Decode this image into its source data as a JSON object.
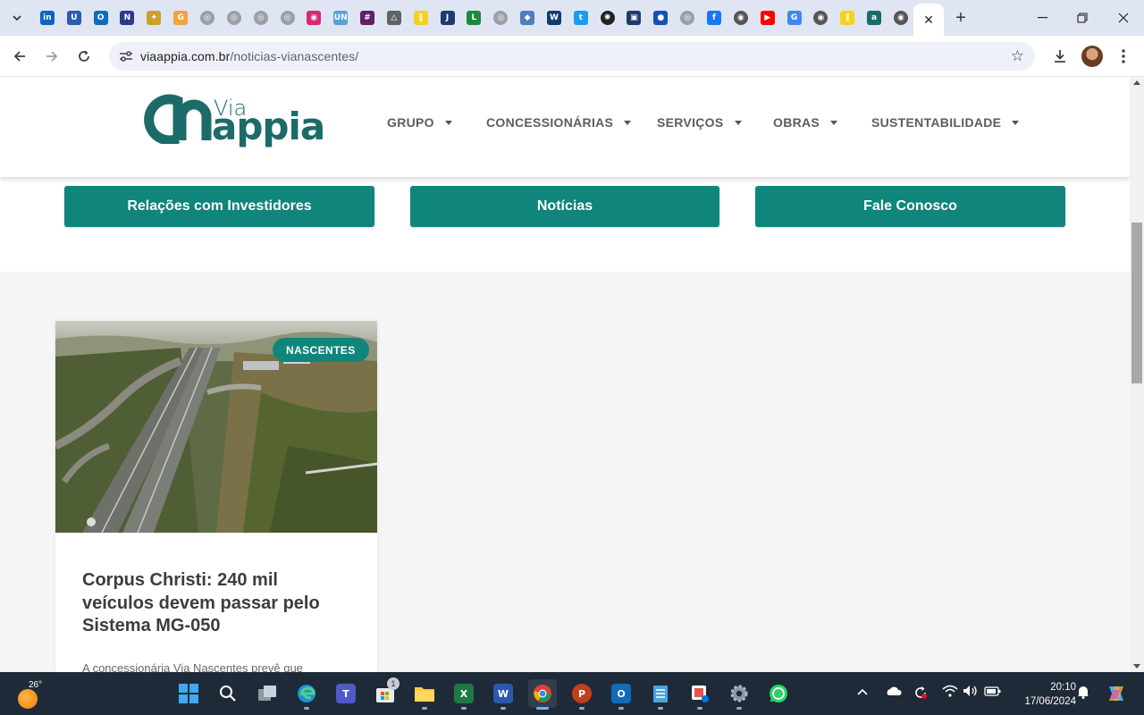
{
  "browser": {
    "tab_close_glyph": "✕",
    "new_tab_glyph": "+",
    "url_host": "viaappia.com.br",
    "url_path": "/noticias-vianascentes/",
    "pinned_tabs": [
      {
        "icon": "linkedin-icon",
        "color": "#0a66c2",
        "glyph": "in"
      },
      {
        "icon": "university-icon",
        "color": "#2a5cae",
        "glyph": "U"
      },
      {
        "icon": "outlook-icon",
        "color": "#0f6cbd",
        "glyph": "O"
      },
      {
        "icon": "portal-icon",
        "color": "#2b3a8c",
        "glyph": "N"
      },
      {
        "icon": "eagle-icon",
        "color": "#c9a227",
        "glyph": "✦"
      },
      {
        "icon": "calendar-icon",
        "color": "#f2a33a",
        "glyph": "G"
      },
      {
        "icon": "globe-icon",
        "color": "#9aa0a6",
        "glyph": "◎"
      },
      {
        "icon": "globe-icon",
        "color": "#9aa0a6",
        "glyph": "◎"
      },
      {
        "icon": "globe-icon",
        "color": "#9aa0a6",
        "glyph": "◎"
      },
      {
        "icon": "globe-icon",
        "color": "#9aa0a6",
        "glyph": "◎"
      },
      {
        "icon": "instagram-icon",
        "color": "#d62976",
        "glyph": "◉"
      },
      {
        "icon": "un-icon",
        "color": "#5aa0d8",
        "glyph": "UN"
      },
      {
        "icon": "slack-icon",
        "color": "#611f69",
        "glyph": "#"
      },
      {
        "icon": "drive-icon",
        "color": "#5f6368",
        "glyph": "△"
      },
      {
        "icon": "bb-icon",
        "color": "#f4d21f",
        "glyph": "∥"
      },
      {
        "icon": "journal-icon",
        "color": "#1d3b70",
        "glyph": "J"
      },
      {
        "icon": "lattes-icon",
        "color": "#1b8a3c",
        "glyph": "L"
      },
      {
        "icon": "globe-icon",
        "color": "#9aa0a6",
        "glyph": "◎"
      },
      {
        "icon": "cube-icon",
        "color": "#4f7fbf",
        "glyph": "◆"
      },
      {
        "icon": "wiley-icon",
        "color": "#143b6f",
        "glyph": "W"
      },
      {
        "icon": "twitter-icon",
        "color": "#1d9bf0",
        "glyph": "t"
      },
      {
        "icon": "openai-icon",
        "color": "#222222",
        "glyph": "✺"
      },
      {
        "icon": "museum-icon",
        "color": "#1f3a6b",
        "glyph": "▣"
      },
      {
        "icon": "gov-icon",
        "color": "#1351b4",
        "glyph": "●"
      },
      {
        "icon": "globe-icon",
        "color": "#9aa0a6",
        "glyph": "◎"
      },
      {
        "icon": "facebook-icon",
        "color": "#1877f2",
        "glyph": "f"
      },
      {
        "icon": "chrome-icon",
        "color": "#555555",
        "glyph": "◉"
      },
      {
        "icon": "youtube-icon",
        "color": "#ff0000",
        "glyph": "▶"
      },
      {
        "icon": "google-icon",
        "color": "#4285f4",
        "glyph": "G"
      },
      {
        "icon": "chrome-icon",
        "color": "#555555",
        "glyph": "◉"
      },
      {
        "icon": "bb-icon",
        "color": "#f4d21f",
        "glyph": "∥"
      },
      {
        "icon": "viaappia-icon",
        "color": "#1c6b68",
        "glyph": "a"
      },
      {
        "icon": "chrome-icon",
        "color": "#555555",
        "glyph": "◉"
      }
    ]
  },
  "site": {
    "logo_via": "Via",
    "logo_appia": "appia",
    "nav": [
      {
        "label": "GRUPO"
      },
      {
        "label": "CONCESSIONÁRIAS"
      },
      {
        "label": "SERVIÇOS"
      },
      {
        "label": "OBRAS"
      },
      {
        "label": "SUSTENTABILIDADE"
      }
    ],
    "cta": [
      {
        "label": "Relações com Investidores"
      },
      {
        "label": "Notícias"
      },
      {
        "label": "Fale Conosco"
      }
    ],
    "accent_color": "#0f857c",
    "brand_color": "#1c6b68"
  },
  "post": {
    "badge": "NASCENTES",
    "title": "Corpus Christi: 240 mil veículos devem passar pelo Sistema MG-050",
    "excerpt": "A concessionária Via Nascentes prevê que"
  },
  "taskbar": {
    "temperature": "26°",
    "time": "20:10",
    "date": "17/06/2024",
    "store_badge": "1",
    "apps": [
      {
        "name": "start-button",
        "label": ""
      },
      {
        "name": "search-button",
        "label": ""
      },
      {
        "name": "task-view-button",
        "label": ""
      },
      {
        "name": "edge-app",
        "label": ""
      },
      {
        "name": "teams-app",
        "label": "T"
      },
      {
        "name": "store-app",
        "label": ""
      },
      {
        "name": "explorer-app",
        "label": ""
      },
      {
        "name": "excel-app",
        "label": "X"
      },
      {
        "name": "word-app",
        "label": "W"
      },
      {
        "name": "chrome-app",
        "label": ""
      },
      {
        "name": "powerpoint-app",
        "label": "P"
      },
      {
        "name": "outlook-new-app",
        "label": "O"
      },
      {
        "name": "notepad-app",
        "label": ""
      },
      {
        "name": "snipping-app",
        "label": ""
      },
      {
        "name": "settings-app",
        "label": ""
      },
      {
        "name": "whatsapp-app",
        "label": ""
      }
    ]
  }
}
